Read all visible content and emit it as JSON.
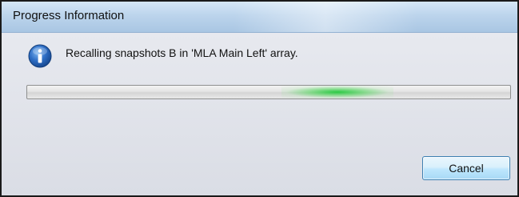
{
  "window": {
    "title": "Progress Information"
  },
  "dialog": {
    "icon": "info-icon",
    "message": "Recalling snapshots B in 'MLA Main Left' array.",
    "progress": {
      "mode": "indeterminate",
      "accent_color": "#22c83c"
    },
    "buttons": {
      "cancel_label": "Cancel"
    }
  },
  "colors": {
    "titlebar": "#bcd4ec",
    "dialog_background": "#dfe3ea",
    "button_border": "#3c7fb1"
  }
}
